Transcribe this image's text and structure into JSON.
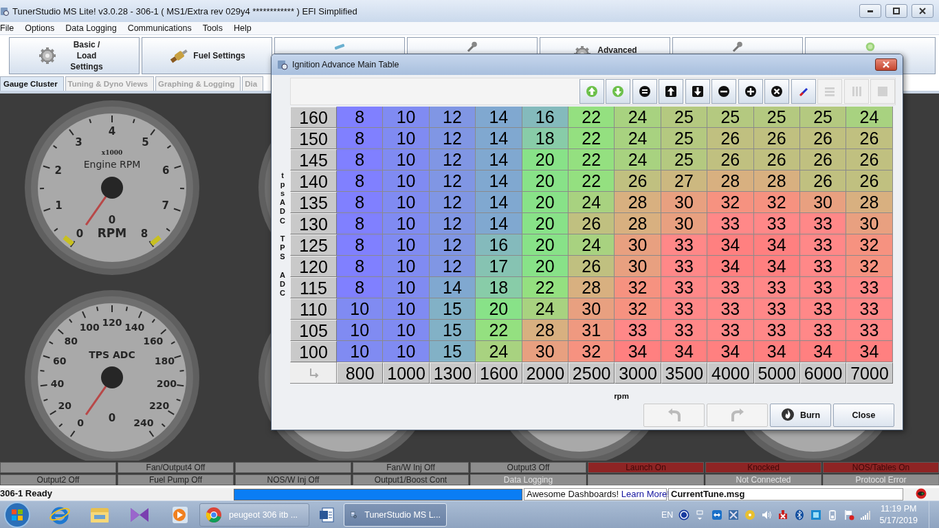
{
  "window": {
    "title": "TunerStudio MS Lite! v3.0.28 - 306-1 ( MS1/Extra rev 029y4 ************ ) EFI Simplified"
  },
  "menu": [
    {
      "label": "File"
    },
    {
      "label": "Options"
    },
    {
      "label": "Data Logging"
    },
    {
      "label": "Communications"
    },
    {
      "label": "Tools"
    },
    {
      "label": "Help"
    }
  ],
  "toolbar": [
    {
      "kind": "gear",
      "label": "Basic / Load Settings"
    },
    {
      "kind": "injector",
      "label": "Fuel Settings"
    },
    {
      "kind": "sensor"
    },
    {
      "kind": "wrench"
    },
    {
      "kind": "gear",
      "label": "Advanced"
    },
    {
      "kind": "wrench"
    },
    {
      "kind": "globe"
    }
  ],
  "tabs": [
    {
      "label": "Gauge Cluster",
      "selected": true
    },
    {
      "label": "Tuning & Dyno Views",
      "selected": false
    },
    {
      "label": "Graphing & Logging",
      "selected": false
    },
    {
      "label": "Dia",
      "selected": false
    }
  ],
  "gauge_rows": [
    [
      {
        "kind": "dial",
        "title": "Engine RPM",
        "multiplier": "x1000",
        "reading": "0",
        "units": "RPM",
        "ticks": [
          "0",
          "1",
          "2",
          "3",
          "4",
          "5",
          "6",
          "7",
          "8"
        ],
        "warning_marks": true
      },
      {
        "kind": "covered"
      }
    ],
    [
      {
        "kind": "dial",
        "title": "TPS ADC",
        "reading": "0",
        "ticks": [
          "0",
          "20",
          "40",
          "60",
          "80",
          "100",
          "120",
          "140",
          "160",
          "180",
          "200",
          "220",
          "240"
        ],
        "warning_marks": false
      },
      {
        "kind": "covered"
      },
      {
        "kind": "covered"
      },
      {
        "kind": "covered"
      }
    ]
  ],
  "indicators": [
    [
      {
        "on": false,
        "disabled": false
      },
      {
        "label": "Fan/Output4 Off",
        "on": false,
        "disabled": false
      },
      {
        "on": false,
        "disabled": false
      },
      {
        "label": "Fan/W Inj Off",
        "on": false,
        "disabled": false
      },
      {
        "label": "Output3 Off",
        "on": false,
        "disabled": false
      },
      {
        "label": "Launch On",
        "on": true,
        "disabled": false
      },
      {
        "label": "Knocked",
        "on": true,
        "disabled": false
      },
      {
        "label": "NOS/Tables On",
        "on": true,
        "disabled": false
      }
    ],
    [
      {
        "label": "Output2 Off",
        "on": false,
        "disabled": false
      },
      {
        "label": "Fuel Pump Off",
        "on": false,
        "disabled": false
      },
      {
        "label": "NOS/W Inj Off",
        "on": false,
        "disabled": false
      },
      {
        "label": "Output1/Boost Cont",
        "on": false,
        "disabled": false
      },
      {
        "label": "Data Logging",
        "on": false,
        "disabled": true
      },
      {
        "on": false,
        "disabled": true
      },
      {
        "label": "Not Connected",
        "on": false,
        "disabled": true
      },
      {
        "label": "Protocol Error",
        "on": false,
        "disabled": true
      }
    ]
  ],
  "status_bar": {
    "message": "306-1 Ready",
    "progress": {
      "level": 1
    },
    "promo": "Awesome Dashboards! ",
    "promo_link": "Learn More!",
    "file": "CurrentTune.msg"
  },
  "dialog": {
    "title": "Ignition Advance Main Table",
    "tools": [
      {
        "kind": "up-circle",
        "disabled": false
      },
      {
        "kind": "down-circle",
        "disabled": false
      },
      {
        "kind": "equals",
        "disabled": false
      },
      {
        "kind": "up",
        "disabled": false
      },
      {
        "kind": "down",
        "disabled": false
      },
      {
        "kind": "minus",
        "disabled": false
      },
      {
        "kind": "plus",
        "disabled": false
      },
      {
        "kind": "cross",
        "disabled": false
      },
      {
        "kind": "pen",
        "disabled": false
      },
      {
        "kind": "rows",
        "disabled": true
      },
      {
        "kind": "columns",
        "disabled": true
      },
      {
        "kind": "block",
        "disabled": true
      }
    ],
    "y_axis_label": "tpsADC TPS ADC",
    "rows": [
      {
        "header": "160",
        "values": [
          "8",
          "10",
          "12",
          "14",
          "16",
          "22",
          "24",
          "25",
          "25",
          "25",
          "25",
          "24"
        ]
      },
      {
        "header": "150",
        "values": [
          "8",
          "10",
          "12",
          "14",
          "18",
          "22",
          "24",
          "25",
          "26",
          "26",
          "26",
          "26"
        ]
      },
      {
        "header": "145",
        "values": [
          "8",
          "10",
          "12",
          "14",
          "20",
          "22",
          "24",
          "25",
          "26",
          "26",
          "26",
          "26"
        ]
      },
      {
        "header": "140",
        "values": [
          "8",
          "10",
          "12",
          "14",
          "20",
          "22",
          "26",
          "27",
          "28",
          "28",
          "26",
          "26"
        ]
      },
      {
        "header": "135",
        "values": [
          "8",
          "10",
          "12",
          "14",
          "20",
          "24",
          "28",
          "30",
          "32",
          "32",
          "30",
          "28"
        ]
      },
      {
        "header": "130",
        "values": [
          "8",
          "10",
          "12",
          "14",
          "20",
          "26",
          "28",
          "30",
          "33",
          "33",
          "33",
          "30"
        ]
      },
      {
        "header": "125",
        "values": [
          "8",
          "10",
          "12",
          "16",
          "20",
          "24",
          "30",
          "33",
          "34",
          "34",
          "33",
          "32"
        ]
      },
      {
        "header": "120",
        "values": [
          "8",
          "10",
          "12",
          "17",
          "20",
          "26",
          "30",
          "33",
          "34",
          "34",
          "33",
          "32"
        ]
      },
      {
        "header": "115",
        "values": [
          "8",
          "10",
          "14",
          "18",
          "22",
          "28",
          "32",
          "33",
          "33",
          "33",
          "33",
          "33"
        ]
      },
      {
        "header": "110",
        "values": [
          "10",
          "10",
          "15",
          "20",
          "24",
          "30",
          "32",
          "33",
          "33",
          "33",
          "33",
          "33"
        ]
      },
      {
        "header": "105",
        "values": [
          "10",
          "10",
          "15",
          "22",
          "28",
          "31",
          "33",
          "33",
          "33",
          "33",
          "33",
          "33"
        ]
      },
      {
        "header": "100",
        "values": [
          "10",
          "10",
          "15",
          "24",
          "30",
          "32",
          "34",
          "34",
          "34",
          "34",
          "34",
          "34"
        ]
      }
    ],
    "columns": [
      "800",
      "1000",
      "1300",
      "1600",
      "2000",
      "2500",
      "3000",
      "3500",
      "4000",
      "5000",
      "6000",
      "7000"
    ],
    "x_axis_label": "rpm",
    "buttons": [
      {
        "kind": "undo",
        "disabled": true
      },
      {
        "kind": "redo",
        "disabled": true
      },
      {
        "kind": "burn",
        "label": "Burn",
        "disabled": false
      },
      {
        "kind": "close",
        "label": "Close",
        "disabled": false
      }
    ]
  },
  "taskbar": {
    "tasks": [
      {
        "kind": "browser",
        "label": "peugeot 306 itb ...",
        "selected": false
      },
      {
        "kind": "document",
        "selected": false
      },
      {
        "kind": "tuner",
        "label": "TunerStudio MS L...",
        "selected": true
      }
    ],
    "language": "EN",
    "time": "11:19 PM",
    "date": "5/17/2019"
  }
}
